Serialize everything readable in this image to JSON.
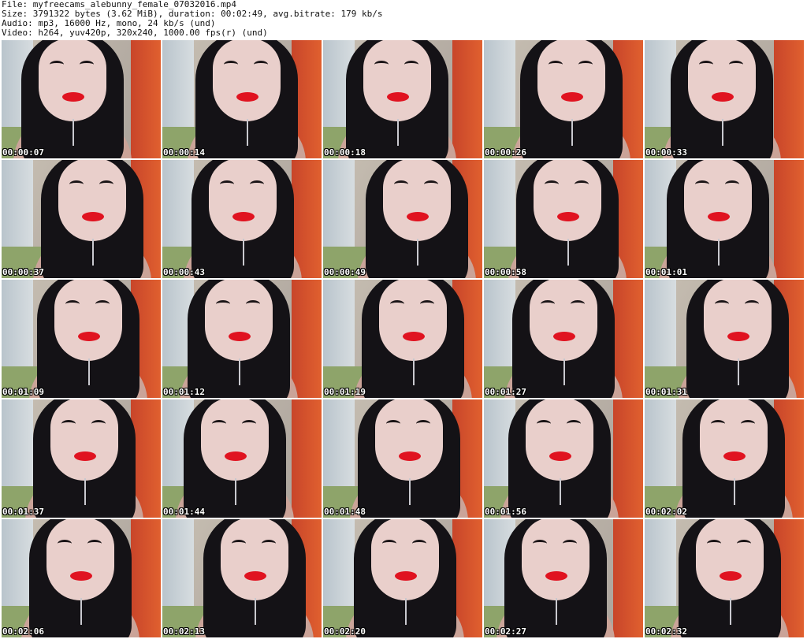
{
  "meta": {
    "file": "File: myfreecams_alebunny_female_07032016.mp4",
    "size": "Size: 3791322 bytes (3.62 MiB), duration: 00:02:49, avg.bitrate: 179 kb/s",
    "audio": "Audio: mp3, 16000 Hz, mono, 24 kb/s (und)",
    "video": "Video: h264, yuv420p, 320x240, 1000.00 fps(r) (und)"
  },
  "thumbnails": [
    {
      "timestamp": "00:00:07"
    },
    {
      "timestamp": "00:00:14"
    },
    {
      "timestamp": "00:00:18"
    },
    {
      "timestamp": "00:00:26"
    },
    {
      "timestamp": "00:00:33"
    },
    {
      "timestamp": "00:00:37"
    },
    {
      "timestamp": "00:00:43"
    },
    {
      "timestamp": "00:00:49"
    },
    {
      "timestamp": "00:00:58"
    },
    {
      "timestamp": "00:01:01"
    },
    {
      "timestamp": "00:01:09"
    },
    {
      "timestamp": "00:01:12"
    },
    {
      "timestamp": "00:01:19"
    },
    {
      "timestamp": "00:01:27"
    },
    {
      "timestamp": "00:01:31"
    },
    {
      "timestamp": "00:01:37"
    },
    {
      "timestamp": "00:01:44"
    },
    {
      "timestamp": "00:01:48"
    },
    {
      "timestamp": "00:01:56"
    },
    {
      "timestamp": "00:02:02"
    },
    {
      "timestamp": "00:02:06"
    },
    {
      "timestamp": "00:02:13"
    },
    {
      "timestamp": "00:02:20"
    },
    {
      "timestamp": "00:02:27"
    },
    {
      "timestamp": "00:02:32"
    }
  ]
}
